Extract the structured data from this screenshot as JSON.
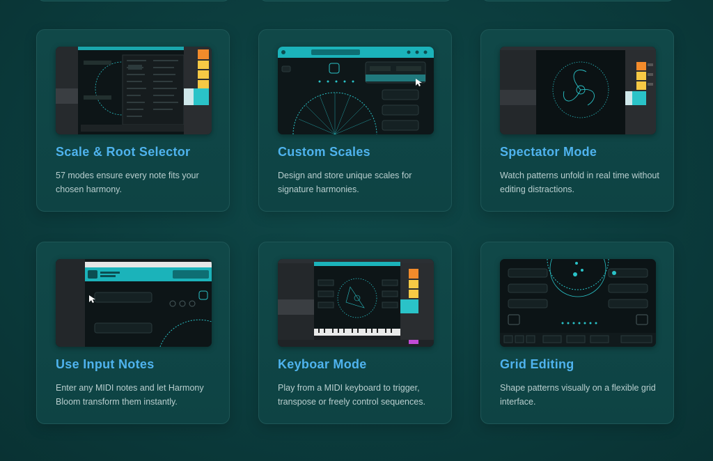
{
  "features": [
    {
      "title": "Scale & Root Selector",
      "description": "57 modes ensure every note fits your chosen harmony.",
      "icon": "scale-dropdown-screenshot"
    },
    {
      "title": "Custom Scales",
      "description": "Design and store unique scales for signature harmonies.",
      "icon": "custom-scales-screenshot"
    },
    {
      "title": "Spectator Mode",
      "description": "Watch patterns unfold in real time without editing distractions.",
      "icon": "spectator-screenshot"
    },
    {
      "title": "Use Input Notes",
      "description": "Enter any MIDI notes and let Harmony Bloom transform them instantly.",
      "icon": "input-notes-screenshot"
    },
    {
      "title": "Keyboar Mode",
      "description": "Play from a MIDI keyboard to trigger, transpose or freely control sequences.",
      "icon": "keyboard-screenshot"
    },
    {
      "title": "Grid Editing",
      "description": "Shape patterns visually on a flexible grid interface.",
      "icon": "grid-screenshot"
    }
  ],
  "theme": {
    "accent": "#4fb3ee",
    "teal": "#2ac3c8",
    "card_bg": "#104848",
    "text": "#b9cfcf"
  }
}
